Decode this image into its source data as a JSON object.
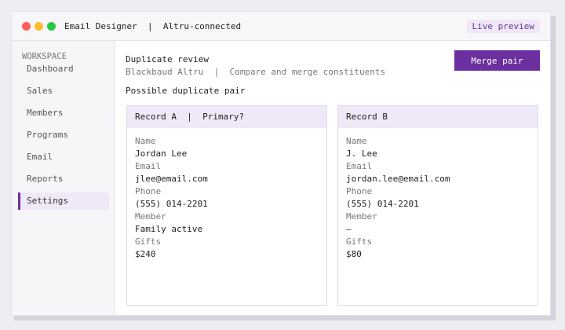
{
  "window": {
    "app_title": "Email Designer  |  Altru-connected",
    "live_preview": "Live preview"
  },
  "sidebar": {
    "section_label": "WORKSPACE",
    "items": [
      {
        "label": "Dashboard"
      },
      {
        "label": "Sales"
      },
      {
        "label": "Members"
      },
      {
        "label": "Programs"
      },
      {
        "label": "Email"
      },
      {
        "label": "Reports"
      },
      {
        "label": "Settings",
        "active": true
      }
    ]
  },
  "main": {
    "title": "Duplicate review",
    "breadcrumb": "Blackbaud Altru  |  Compare and merge constituents",
    "merge_button": "Merge pair",
    "section_title": "Possible duplicate pair",
    "record_a": {
      "header": "Record A  |  Primary?",
      "fields": [
        {
          "label": "Name",
          "value": "Jordan Lee"
        },
        {
          "label": "Email",
          "value": "jlee@email.com"
        },
        {
          "label": "Phone",
          "value": "(555) 014-2201"
        },
        {
          "label": "Member",
          "value": "Family active"
        },
        {
          "label": "Gifts",
          "value": "$240"
        }
      ]
    },
    "record_b": {
      "header": "Record B",
      "fields": [
        {
          "label": "Name",
          "value": "J. Lee"
        },
        {
          "label": "Email",
          "value": "jordan.lee@email.com"
        },
        {
          "label": "Phone",
          "value": "(555) 014-2201"
        },
        {
          "label": "Member",
          "value": "–"
        },
        {
          "label": "Gifts",
          "value": "$80"
        }
      ]
    }
  },
  "colors": {
    "accent": "#6b2fa0",
    "accent_tint": "#efe8f7"
  }
}
